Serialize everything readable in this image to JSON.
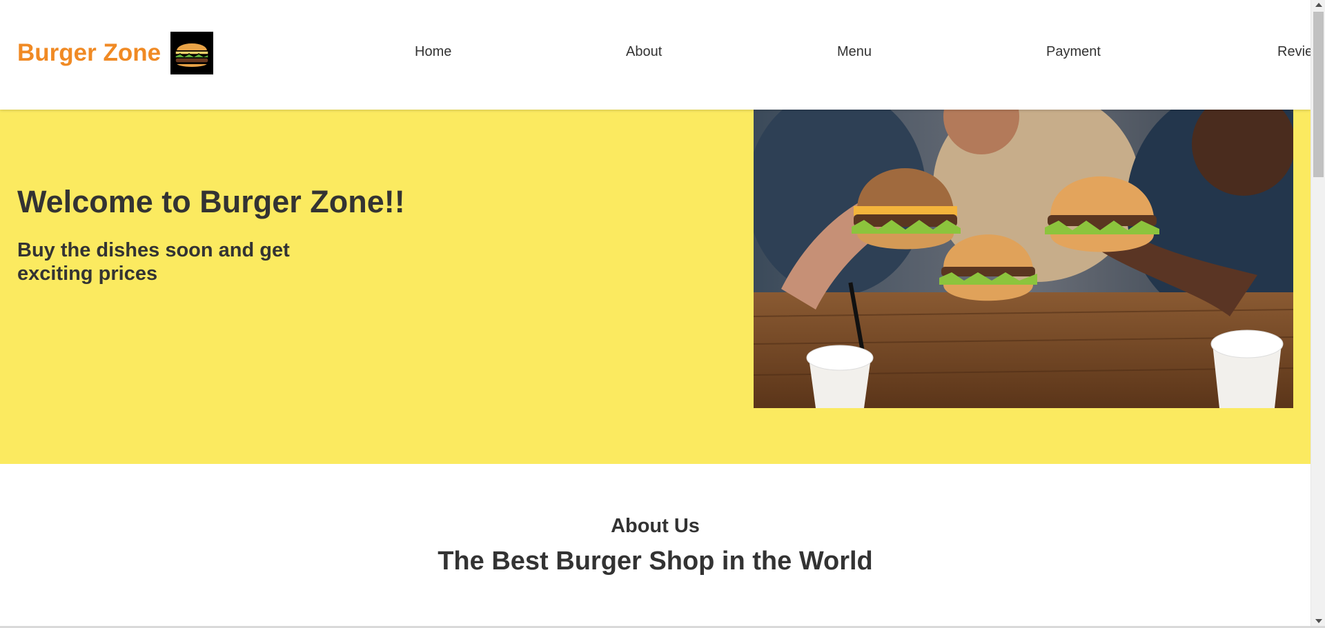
{
  "header": {
    "brand": "Burger Zone",
    "logo_icon": "burger-icon",
    "nav": [
      {
        "label": "Home"
      },
      {
        "label": "About"
      },
      {
        "label": "Menu"
      },
      {
        "label": "Payment"
      },
      {
        "label": "Revie"
      }
    ]
  },
  "hero": {
    "title": "Welcome to Burger Zone!!",
    "subtitle": "Buy the dishes soon and get exciting prices",
    "image": "friends-holding-burgers-photo"
  },
  "about": {
    "title": "About Us",
    "heading": "The Best Burger Shop in the World"
  },
  "colors": {
    "brand": "#f08a24",
    "hero_bg": "#fbea60",
    "text": "#333333"
  }
}
